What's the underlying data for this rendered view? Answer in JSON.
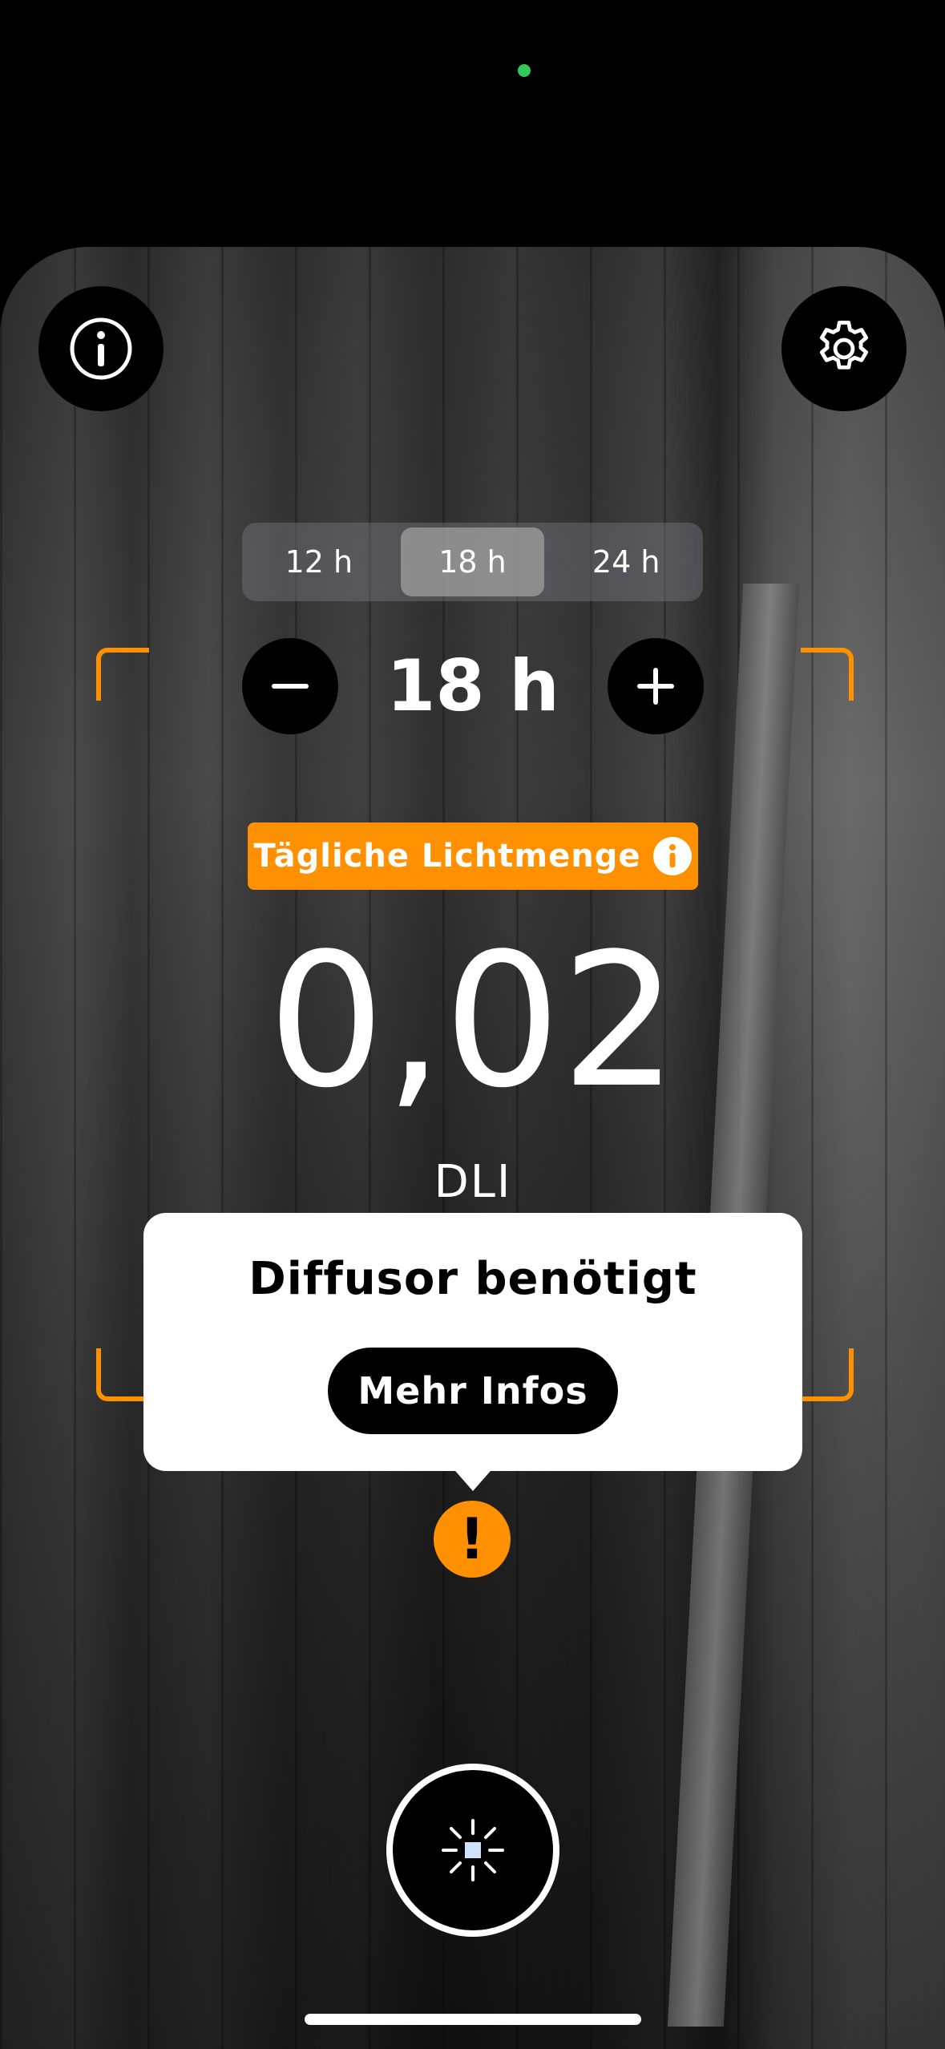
{
  "header": {
    "info_icon": "info-circle-icon",
    "settings_icon": "gear-icon"
  },
  "photoperiod": {
    "options": [
      "12 h",
      "18 h",
      "24 h"
    ],
    "selected": "18 h",
    "value": "18 h",
    "minus_icon": "minus-icon",
    "plus_icon": "plus-icon"
  },
  "measurement": {
    "badge_label": "Tägliche Lichtmenge",
    "value": "0,02",
    "unit": "DLI"
  },
  "popover": {
    "title": "Diffusor benötigt",
    "button_label": "Mehr Infos",
    "warning_glyph": "!"
  },
  "colors": {
    "accent": "#ff9000",
    "status_dot": "#35c759"
  }
}
